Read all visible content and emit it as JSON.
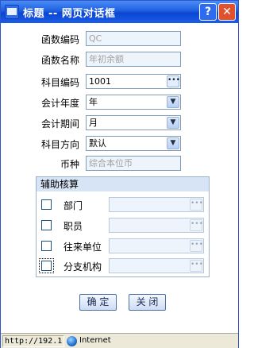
{
  "window": {
    "title": "标题 -- 网页对话框",
    "help_glyph": "?",
    "close_glyph": "✕"
  },
  "form": {
    "function_code": {
      "label": "函数编码",
      "value": "QC"
    },
    "function_name": {
      "label": "函数名称",
      "value": "年初余额"
    },
    "account_code": {
      "label": "科目编码",
      "value": "1001"
    },
    "fiscal_year": {
      "label": "会计年度",
      "value": "年"
    },
    "fiscal_period": {
      "label": "会计期间",
      "value": "月"
    },
    "account_direction": {
      "label": "科目方向",
      "value": "默认"
    },
    "currency": {
      "label": "币种",
      "value": "综合本位币"
    }
  },
  "aux": {
    "title": "辅助核算",
    "items": [
      {
        "label": "部门"
      },
      {
        "label": "职员"
      },
      {
        "label": "往来单位"
      },
      {
        "label": "分支机构"
      }
    ]
  },
  "buttons": {
    "ok": "确 定",
    "close": "关 闭"
  },
  "status": {
    "url": "http://192.1",
    "zone": "Internet"
  },
  "icons": {
    "browse": "ellipsis-icon",
    "dropdown": "chevron-down-icon"
  }
}
